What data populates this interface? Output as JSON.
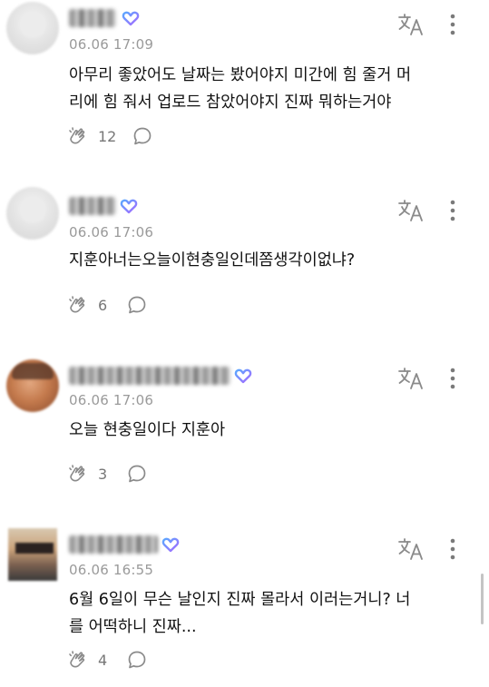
{
  "comments": [
    {
      "time": "06.06 17:09",
      "text": "아무리 좋았어도 날짜는 봤어야지 미간에 힘 줄거 머\n리에 힘 줘서 업로드 참았어야지 진짜 뭐하는거야",
      "likes": "12"
    },
    {
      "time": "06.06 17:06",
      "text": "지훈아너는오늘이현충일인데쫌생각이없냐?",
      "likes": "6"
    },
    {
      "time": "06.06 17:06",
      "text": "오늘 현충일이다 지훈아",
      "likes": "3"
    },
    {
      "time": "06.06 16:55",
      "text": "6월 6일이 무슨 날인지 진짜 몰라서 이러는거니? 너\n를 어떡하니 진짜...",
      "likes": "4"
    }
  ],
  "colors": {
    "badge_gradient_start": "#5aa7ff",
    "badge_gradient_end": "#a66bff",
    "meta_text": "#9a9a9a",
    "icon_grey": "#8a8a8a"
  },
  "icons": {
    "translate": "translate-icon",
    "more": "more-vertical-icon",
    "like": "hand-clap-icon",
    "reply": "speech-bubble-icon",
    "badge": "heart-badge-icon"
  }
}
